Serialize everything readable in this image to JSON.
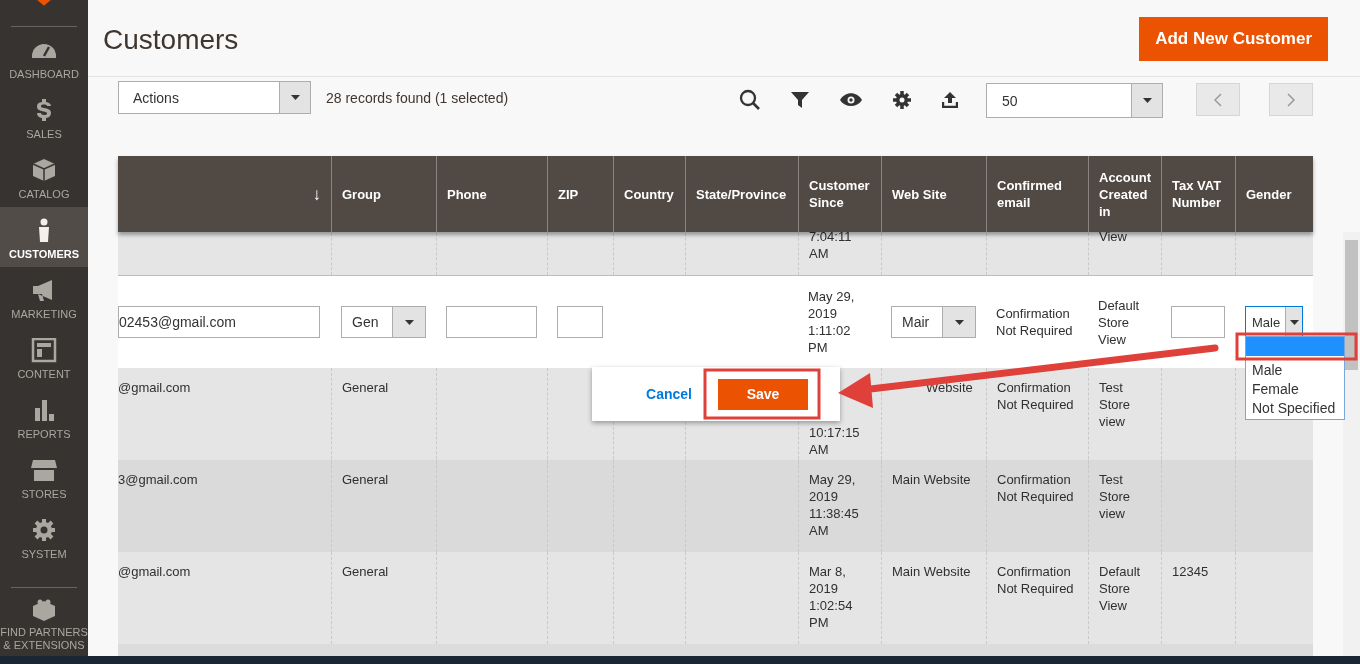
{
  "sidebar": {
    "items": [
      {
        "label": "DASHBOARD",
        "selected": false
      },
      {
        "label": "SALES",
        "selected": false
      },
      {
        "label": "CATALOG",
        "selected": false
      },
      {
        "label": "CUSTOMERS",
        "selected": true
      },
      {
        "label": "MARKETING",
        "selected": false
      },
      {
        "label": "CONTENT",
        "selected": false
      },
      {
        "label": "REPORTS",
        "selected": false
      },
      {
        "label": "STORES",
        "selected": false
      },
      {
        "label": "SYSTEM",
        "selected": false
      },
      {
        "label": "FIND PARTNERS\n& EXTENSIONS",
        "selected": false
      }
    ]
  },
  "page": {
    "title": "Customers",
    "primary_button": "Add New Customer"
  },
  "toolbar": {
    "actions_select": "Actions",
    "records": "28 records found (1 selected)",
    "per_page": "50"
  },
  "table": {
    "columns": [
      {
        "sort_indicator": "↓"
      },
      {
        "label": "Group"
      },
      {
        "label": "Phone"
      },
      {
        "label": "ZIP"
      },
      {
        "label": "Country"
      },
      {
        "label": "State/Province"
      },
      {
        "label": "Customer\nSince"
      },
      {
        "label": "Web Site"
      },
      {
        "label": "Confirmed\nemail"
      },
      {
        "label": "Account\nCreated\nin"
      },
      {
        "label": "Tax VAT\nNumber"
      },
      {
        "label": "Gender"
      }
    ],
    "rows": [
      {
        "kind": "partial",
        "cells": [
          null,
          null,
          null,
          null,
          null,
          null,
          "7:04:11\nAM",
          null,
          null,
          "View",
          null,
          null
        ]
      },
      {
        "kind": "editing",
        "cells": [
          {
            "kind": "input",
            "value": "02453@gmail.com"
          },
          {
            "kind": "select",
            "value": "Gen"
          },
          {
            "kind": "input"
          },
          {
            "kind": "input"
          },
          null,
          null,
          "May 29,\n2019\n1:11:02\nPM",
          {
            "kind": "select",
            "value": "Mair"
          },
          "Confirmation\nNot Required",
          "Default\nStore\nView",
          {
            "kind": "input"
          },
          {
            "kind": "select",
            "value": "Male",
            "open": true,
            "blank_option_highlighted": true,
            "options": [
              "Male",
              "Female",
              "Not Specified"
            ]
          }
        ]
      },
      {
        "kind": "normal",
        "cells": [
          "@gmail.com",
          "General",
          null,
          null,
          null,
          null,
          {
            "kind": "cut-top",
            "text": "10:17:15\nAM"
          },
          {
            "kind": "cut-left",
            "text": "Website"
          },
          "Confirmation\nNot Required",
          "Test\nStore\nview",
          null,
          null
        ]
      },
      {
        "kind": "normal",
        "cells": [
          "3@gmail.com",
          "General",
          null,
          null,
          null,
          null,
          "May 29,\n2019\n11:38:45\nAM",
          "Main Website",
          "Confirmation\nNot Required",
          "Test\nStore\nview",
          null,
          null
        ]
      },
      {
        "kind": "normal",
        "cells": [
          "@gmail.com",
          "General",
          null,
          null,
          null,
          null,
          "Mar 8,\n2019\n1:02:54\nPM",
          "Main Website",
          "Confirmation\nNot Required",
          "Default\nStore\nView",
          "12345",
          null
        ]
      }
    ],
    "edit_actions": {
      "cancel": "Cancel",
      "save": "Save"
    }
  }
}
